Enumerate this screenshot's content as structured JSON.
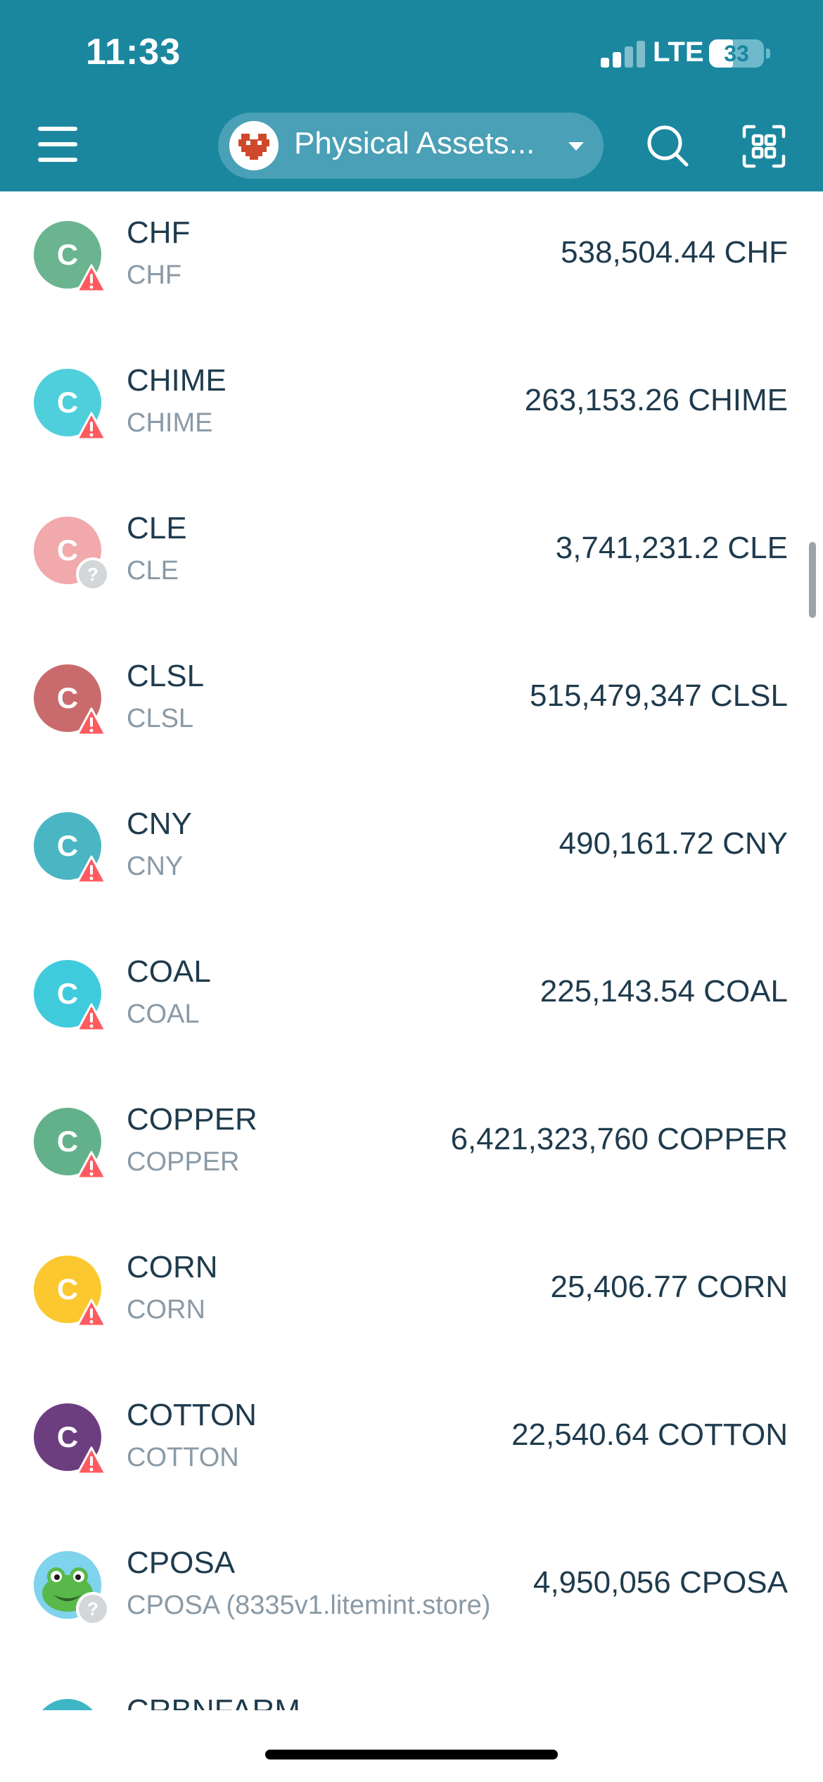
{
  "status_bar": {
    "time": "11:33",
    "network": "LTE",
    "battery": "33"
  },
  "header": {
    "account_name": "Physical Assets...",
    "menu_icon": "hamburger-menu-icon",
    "search_icon": "search-icon",
    "scan_icon": "qr-scan-icon",
    "background_color": "#1a879f"
  },
  "tokens": [
    {
      "symbol": "CHF",
      "name": "CHF",
      "balance": "538,504.44 CHF",
      "icon_color": "#6ab48f",
      "badge": "warning"
    },
    {
      "symbol": "CHIME",
      "name": "CHIME",
      "balance": "263,153.26 CHIME",
      "icon_color": "#4fcfdc",
      "badge": "warning"
    },
    {
      "symbol": "CLE",
      "name": "CLE",
      "balance": "3,741,231.2 CLE",
      "icon_color": "#f2a9ab",
      "badge": "unknown"
    },
    {
      "symbol": "CLSL",
      "name": "CLSL",
      "balance": "515,479,347 CLSL",
      "icon_color": "#c96b6c",
      "badge": "warning"
    },
    {
      "symbol": "CNY",
      "name": "CNY",
      "balance": "490,161.72 CNY",
      "icon_color": "#4ab6c3",
      "badge": "warning"
    },
    {
      "symbol": "COAL",
      "name": "COAL",
      "balance": "225,143.54 COAL",
      "icon_color": "#40cbdd",
      "badge": "warning"
    },
    {
      "symbol": "COPPER",
      "name": "COPPER",
      "balance": "6,421,323,760 COPPER",
      "icon_color": "#63b18b",
      "badge": "warning"
    },
    {
      "symbol": "CORN",
      "name": "CORN",
      "balance": "25,406.77 CORN",
      "icon_color": "#fbc830",
      "badge": "warning"
    },
    {
      "symbol": "COTTON",
      "name": "COTTON",
      "balance": "22,540.64 COTTON",
      "icon_color": "#6c3e80",
      "badge": "warning"
    },
    {
      "symbol": "CPOSA",
      "name": "CPOSA (8335v1.litemint.store)",
      "balance": "4,950,056 CPOSA",
      "icon_color": "#59c3e0",
      "badge": "unknown",
      "icon": "frog-avatar-icon"
    },
    {
      "symbol": "CRBNFARM",
      "name": "",
      "balance": "",
      "icon_color": "#3fb6c6",
      "badge": "none"
    }
  ],
  "icon_letter": "C"
}
